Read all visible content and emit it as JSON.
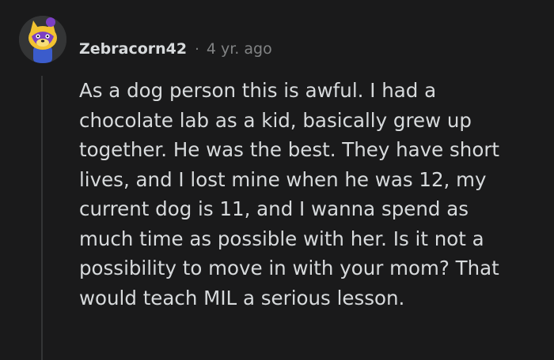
{
  "comment": {
    "author": "Zebracorn42",
    "separator": "·",
    "age": "4 yr. ago",
    "body_lines": [
      "As a dog person this is awful. I had a",
      "chocolate lab as a kid, basically grew up",
      "together. He was the best. They have short",
      "lives, and I lost mine when he was 12, my",
      "current dog is 11, and I wanna spend as",
      "much time as possible with her. Is it not a",
      "possibility to move in with your mom? That",
      "would teach MIL a serious lesson."
    ]
  },
  "colors": {
    "background": "#1a1a1b",
    "text": "#d7dadc",
    "meta": "#818384",
    "thread_line": "#343536",
    "avatar_yellow": "#f2c230",
    "avatar_purple": "#7b3fc4",
    "avatar_blue": "#3b5ccc"
  },
  "icons": {
    "avatar": "snoo-yellow-creature-avatar"
  }
}
